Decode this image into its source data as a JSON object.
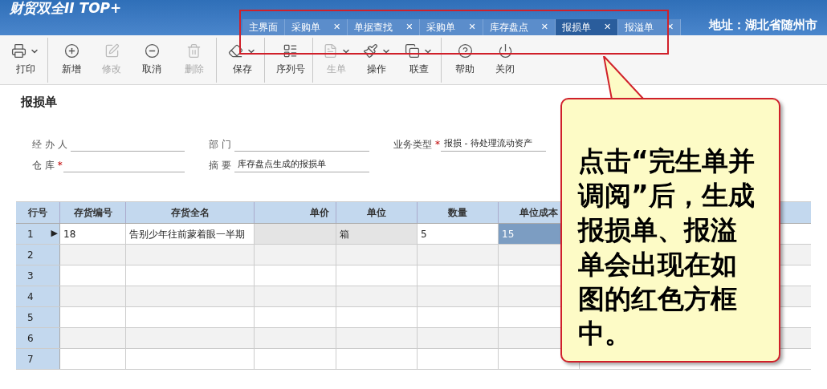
{
  "header": {
    "logo_text": "财贸双全II TOP+",
    "address": "地址：湖北省随州市"
  },
  "tabs": [
    {
      "label": "主界面",
      "selected": false,
      "closable": false
    },
    {
      "label": "采购单",
      "selected": false,
      "closable": true
    },
    {
      "label": "单据查找",
      "selected": false,
      "closable": true
    },
    {
      "label": "采购单",
      "selected": false,
      "closable": true
    },
    {
      "label": "库存盘点",
      "selected": false,
      "closable": true
    },
    {
      "label": "报损单",
      "selected": true,
      "closable": true
    },
    {
      "label": "报溢单",
      "selected": false,
      "closable": true
    }
  ],
  "tab_close_glyph": "✕",
  "toolbar": [
    {
      "kind": "print",
      "label": "打印",
      "disabled": false,
      "has_menu": true,
      "group_end": true
    },
    {
      "kind": "add",
      "label": "新增",
      "disabled": false,
      "has_menu": false,
      "group_end": false
    },
    {
      "kind": "edit",
      "label": "修改",
      "disabled": true,
      "has_menu": false,
      "group_end": false
    },
    {
      "kind": "cancel",
      "label": "取消",
      "disabled": false,
      "has_menu": false,
      "group_end": false
    },
    {
      "kind": "delete",
      "label": "删除",
      "disabled": true,
      "has_menu": false,
      "group_end": true
    },
    {
      "kind": "save",
      "label": "保存",
      "disabled": false,
      "has_menu": true,
      "group_end": true
    },
    {
      "kind": "serial",
      "label": "序列号",
      "disabled": false,
      "has_menu": false,
      "group_end": true
    },
    {
      "kind": "generate",
      "label": "生单",
      "disabled": true,
      "has_menu": true,
      "group_end": false
    },
    {
      "kind": "operate",
      "label": "操作",
      "disabled": false,
      "has_menu": true,
      "group_end": false
    },
    {
      "kind": "lookup",
      "label": "联查",
      "disabled": false,
      "has_menu": true,
      "group_end": true
    },
    {
      "kind": "help",
      "label": "帮助",
      "disabled": false,
      "has_menu": false,
      "group_end": false
    },
    {
      "kind": "close",
      "label": "关闭",
      "disabled": false,
      "has_menu": false,
      "group_end": false
    }
  ],
  "form": {
    "title": "报损单",
    "required_mark": "*",
    "fields": [
      {
        "label": "经 办 人",
        "required": false
      },
      {
        "label": "部 门",
        "required": false
      },
      {
        "label": "业务类型",
        "required": true,
        "value": "报损 - 待处理流动资产"
      },
      {
        "label": "仓 库",
        "required": true
      },
      {
        "label": "摘 要",
        "required": false,
        "value": "库存盘点生成的报损单"
      }
    ]
  },
  "table": {
    "current_marker": "▶",
    "columns": [
      "行号",
      "存货编号",
      "存货全名",
      "单价",
      "单位",
      "数量",
      "单位成本"
    ],
    "rows": [
      {
        "number": "1",
        "current": true,
        "cells": [
          {
            "text": "18",
            "readonly": false,
            "selected": false
          },
          {
            "text": "告别少年往前蒙着眼一半期",
            "readonly": false,
            "selected": false
          },
          {
            "readonly": true,
            "selected": false
          },
          {
            "text": "箱",
            "readonly": true,
            "selected": false
          },
          {
            "text": "5",
            "readonly": false,
            "selected": false
          },
          {
            "text": "15",
            "readonly": false,
            "selected": true
          }
        ]
      },
      {
        "number": "2",
        "current": false
      },
      {
        "number": "3",
        "current": false
      },
      {
        "number": "4",
        "current": false
      },
      {
        "number": "5",
        "current": false
      },
      {
        "number": "6",
        "current": false
      },
      {
        "number": "7",
        "current": false
      }
    ]
  },
  "callout": {
    "text": "点击“完生单并调阅”后，生成报损单、报溢单会出现在如图的红色方框中。"
  }
}
